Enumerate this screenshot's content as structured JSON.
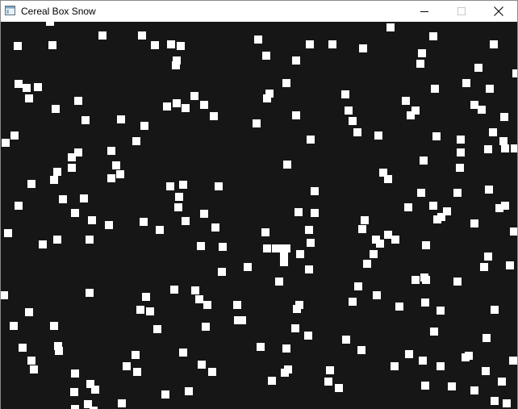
{
  "window": {
    "title": "Cereal Box Snow",
    "app_icon": "app-window-icon",
    "controls": {
      "minimize_icon": "minimize-icon",
      "maximize_icon": "maximize-icon",
      "close_icon": "close-icon"
    }
  },
  "scene": {
    "background_color": "#161616",
    "flake_color": "#ffffff",
    "flake_count": 224
  }
}
